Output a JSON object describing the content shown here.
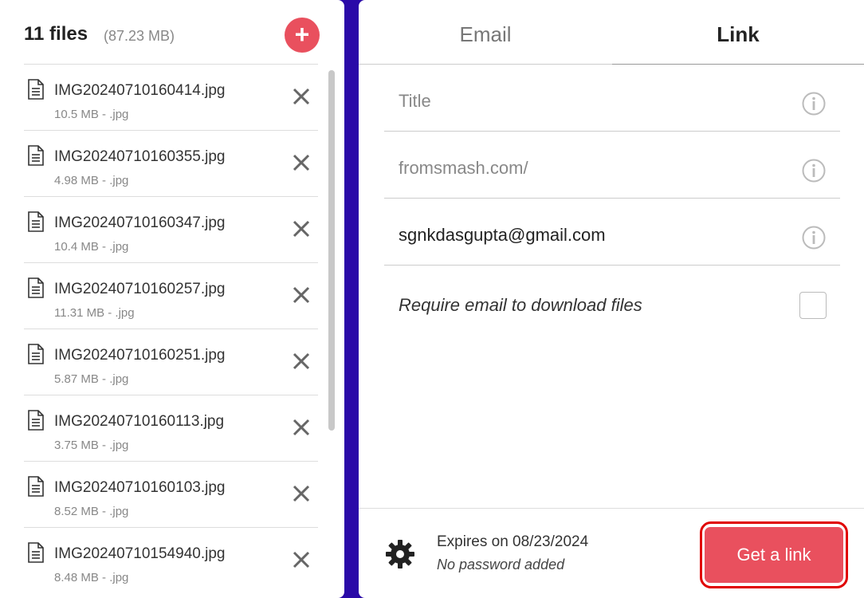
{
  "files_panel": {
    "count_label": "11 files",
    "total_size": "(87.23 MB)",
    "add_symbol": "+",
    "files": [
      {
        "name": "IMG20240710160414.jpg",
        "meta": "10.5 MB  -  .jpg"
      },
      {
        "name": "IMG20240710160355.jpg",
        "meta": "4.98 MB  -  .jpg"
      },
      {
        "name": "IMG20240710160347.jpg",
        "meta": "10.4 MB  -  .jpg"
      },
      {
        "name": "IMG20240710160257.jpg",
        "meta": "11.31 MB  -  .jpg"
      },
      {
        "name": "IMG20240710160251.jpg",
        "meta": "5.87 MB  -  .jpg"
      },
      {
        "name": "IMG20240710160113.jpg",
        "meta": "3.75 MB  -  .jpg"
      },
      {
        "name": "IMG20240710160103.jpg",
        "meta": "8.52 MB  -  .jpg"
      },
      {
        "name": "IMG20240710154940.jpg",
        "meta": "8.48 MB  -  .jpg"
      }
    ]
  },
  "tabs": {
    "email": "Email",
    "link": "Link",
    "active": "Link"
  },
  "form": {
    "title_placeholder": "Title",
    "url_placeholder": "fromsmash.com/",
    "email_value": "sgnkdasgupta@gmail.com",
    "require_email_label": "Require email to download files",
    "require_email_checked": false
  },
  "footer": {
    "expires": "Expires on 08/23/2024",
    "password": "No password added",
    "get_link_label": "Get a link"
  },
  "colors": {
    "accent": "#e9505e",
    "background": "#2a0aa8",
    "highlight_outline": "#e00000"
  }
}
